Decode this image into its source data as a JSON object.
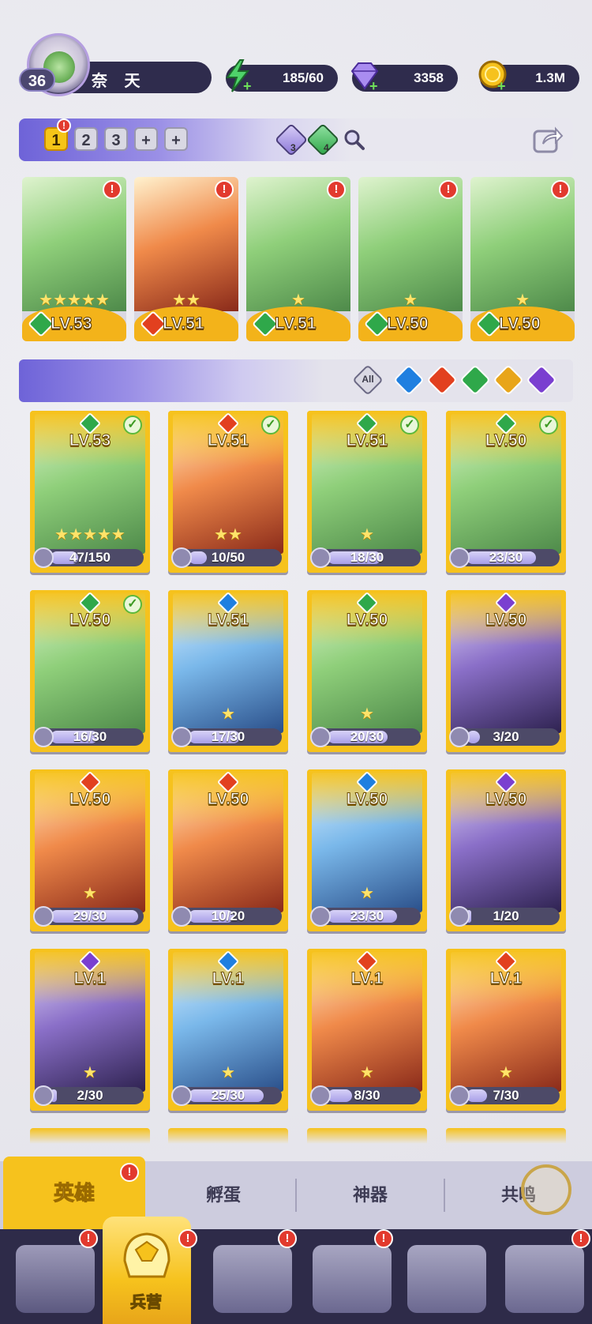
{
  "player": {
    "level": "36",
    "name": "奈 天"
  },
  "resources": [
    {
      "name": "energy",
      "icon": "lightning-icon",
      "value": "185/60"
    },
    {
      "name": "gems",
      "icon": "gem-icon",
      "value": "3358"
    },
    {
      "name": "gold",
      "icon": "coin-icon",
      "value": "1.3M"
    }
  ],
  "team_bar": {
    "slots": [
      "1",
      "2",
      "3",
      "+",
      "+"
    ],
    "active_slot": "1",
    "purple_crystal_count": "3",
    "green_crystal_count": "4"
  },
  "team": [
    {
      "level": "LV.53",
      "element": "wind",
      "stars": "★★★★★"
    },
    {
      "level": "LV.51",
      "element": "fire",
      "stars": "★★"
    },
    {
      "level": "LV.51",
      "element": "wind",
      "stars": "★"
    },
    {
      "level": "LV.50",
      "element": "wind",
      "stars": "★"
    },
    {
      "level": "LV.50",
      "element": "wind",
      "stars": "★"
    }
  ],
  "filters": {
    "all_label": "All",
    "elements": [
      "water",
      "fire",
      "wind",
      "light",
      "dark"
    ]
  },
  "heroes": [
    {
      "level": "LV.53",
      "element": "wind",
      "progress": "47/150",
      "fraction": 0.31,
      "checked": true,
      "stars": "★★★★★"
    },
    {
      "level": "LV.51",
      "element": "fire",
      "progress": "10/50",
      "fraction": 0.2,
      "checked": true,
      "stars": "★★"
    },
    {
      "level": "LV.51",
      "element": "wind",
      "progress": "18/30",
      "fraction": 0.6,
      "checked": true,
      "stars": "★"
    },
    {
      "level": "LV.50",
      "element": "wind",
      "progress": "23/30",
      "fraction": 0.77,
      "checked": true,
      "stars": ""
    },
    {
      "level": "LV.50",
      "element": "wind",
      "progress": "16/30",
      "fraction": 0.53,
      "checked": true,
      "stars": ""
    },
    {
      "level": "LV.51",
      "element": "water",
      "progress": "17/30",
      "fraction": 0.57,
      "checked": false,
      "stars": "★"
    },
    {
      "level": "LV.50",
      "element": "wind",
      "progress": "20/30",
      "fraction": 0.67,
      "checked": false,
      "stars": "★"
    },
    {
      "level": "LV.50",
      "element": "dark",
      "progress": "3/20",
      "fraction": 0.15,
      "checked": false,
      "stars": ""
    },
    {
      "level": "LV.50",
      "element": "fire",
      "progress": "29/30",
      "fraction": 0.97,
      "checked": false,
      "stars": "★"
    },
    {
      "level": "LV.50",
      "element": "fire",
      "progress": "10/20",
      "fraction": 0.5,
      "checked": false,
      "stars": ""
    },
    {
      "level": "LV.50",
      "element": "water",
      "progress": "23/30",
      "fraction": 0.77,
      "checked": false,
      "stars": "★"
    },
    {
      "level": "LV.50",
      "element": "dark",
      "progress": "1/20",
      "fraction": 0.05,
      "checked": false,
      "stars": ""
    },
    {
      "level": "LV.1",
      "element": "dark",
      "progress": "2/30",
      "fraction": 0.07,
      "checked": false,
      "stars": "★"
    },
    {
      "level": "LV.1",
      "element": "water",
      "progress": "25/30",
      "fraction": 0.83,
      "checked": false,
      "stars": "★"
    },
    {
      "level": "LV.1",
      "element": "fire",
      "progress": "8/30",
      "fraction": 0.27,
      "checked": false,
      "stars": "★"
    },
    {
      "level": "LV.1",
      "element": "fire",
      "progress": "7/30",
      "fraction": 0.23,
      "checked": false,
      "stars": "★"
    }
  ],
  "sub_tabs": [
    "英雄",
    "孵蛋",
    "神器",
    "共鸣"
  ],
  "active_sub_tab": "英雄",
  "nav": {
    "active_label": "兵营"
  },
  "colors": {
    "wind": "#2fa84a",
    "fire": "#e2401f",
    "water": "#1f7fe0",
    "dark": "#7a3fd0",
    "light": "#e8a51a",
    "card_gold": "#f6c21d",
    "panel": "#2f2c4d",
    "alert": "#e23a2e"
  }
}
